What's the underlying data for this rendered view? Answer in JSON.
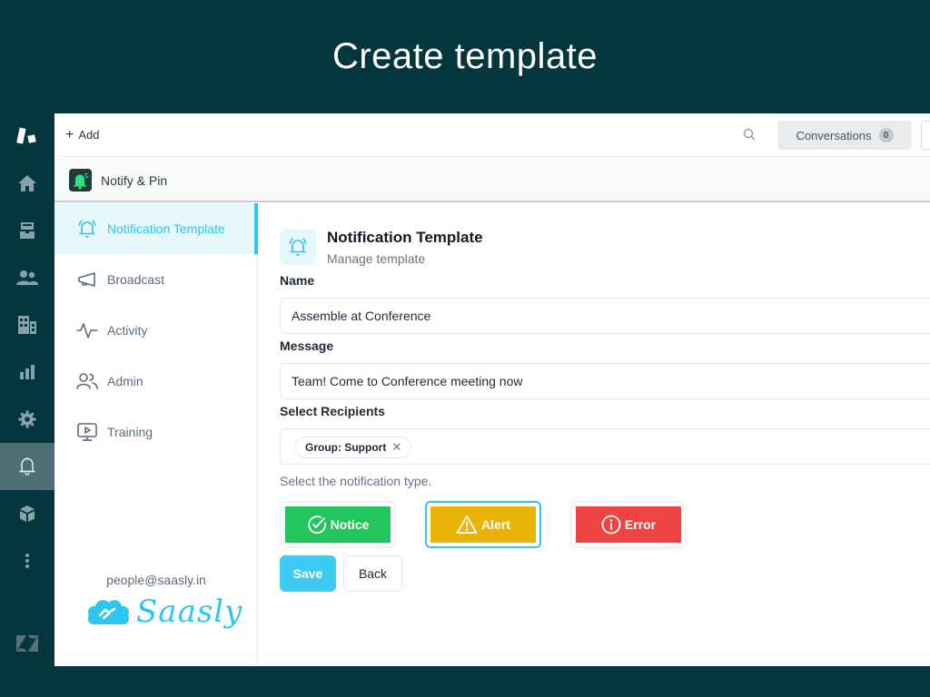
{
  "banner": {
    "title": "Create template"
  },
  "rail": {
    "items": [
      {
        "icon": "zendesk-logo-icon"
      },
      {
        "icon": "home-icon"
      },
      {
        "icon": "inbox-icon"
      },
      {
        "icon": "users-icon"
      },
      {
        "icon": "organizations-icon"
      },
      {
        "icon": "reporting-icon"
      },
      {
        "icon": "gear-icon"
      },
      {
        "icon": "bell-icon",
        "active": true
      },
      {
        "icon": "apps-box-icon"
      },
      {
        "icon": "more-vertical-icon"
      },
      {
        "icon": "zendesk-z-icon"
      }
    ]
  },
  "topbar": {
    "add_label": "Add",
    "conversations_label": "Conversations",
    "conversations_count": "0"
  },
  "appbar": {
    "app_name": "Notify & Pin"
  },
  "sidebar": {
    "items": [
      {
        "label": "Notification Template",
        "icon": "bell-ringing-icon",
        "active": true
      },
      {
        "label": "Broadcast",
        "icon": "megaphone-icon"
      },
      {
        "label": "Activity",
        "icon": "activity-icon"
      },
      {
        "label": "Admin",
        "icon": "users-icon"
      },
      {
        "label": "Training",
        "icon": "monitor-play-icon"
      }
    ],
    "email": "people@saasly.in",
    "brand": "Saasly"
  },
  "content": {
    "title": "Notification Template",
    "subtitle": "Manage template",
    "name_label": "Name",
    "name_value": "Assemble at Conference",
    "message_label": "Message",
    "message_value": "Team! Come to Conference meeting now",
    "recipients_label": "Select Recipients",
    "recipients": [
      {
        "label": "Group: Support"
      }
    ],
    "type_hint": "Select the notification type.",
    "types": [
      {
        "label": "Notice",
        "icon": "check-circle-icon",
        "color": "#22c55e",
        "selected": false
      },
      {
        "label": "Alert",
        "icon": "warning-triangle-icon",
        "color": "#eab308",
        "selected": true
      },
      {
        "label": "Error",
        "icon": "info-circle-icon",
        "color": "#ef4444",
        "selected": false
      }
    ],
    "save_label": "Save",
    "back_label": "Back"
  }
}
